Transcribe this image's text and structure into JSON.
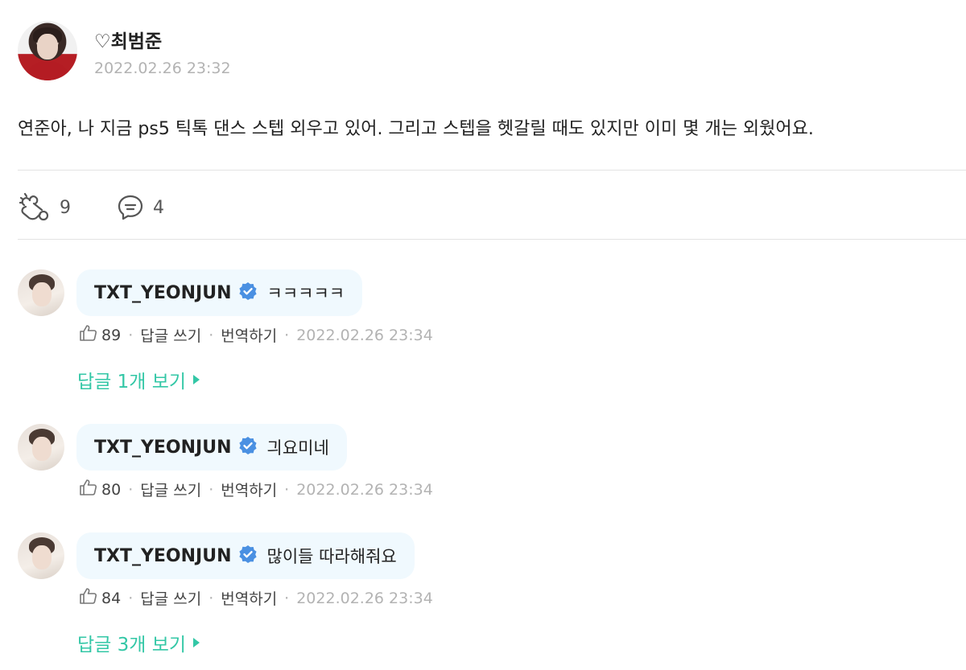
{
  "post": {
    "author": "♡최범준",
    "timestamp": "2022.02.26 23:32",
    "body": "연준아, 나 지금 ps5 틱톡 댄스 스텝 외우고 있어. 그리고 스텝을 헷갈릴 때도 있지만 이미 몇 개는 외웠어요.",
    "like_count": "9",
    "comment_count": "4"
  },
  "comments": [
    {
      "username": "TXT_YEONJUN",
      "text": "ㅋㅋㅋㅋㅋ",
      "likes": "89",
      "reply_label": "답글 쓰기",
      "translate_label": "번역하기",
      "timestamp": "2022.02.26 23:34",
      "view_replies": "답글 1개 보기"
    },
    {
      "username": "TXT_YEONJUN",
      "text": "긔요미네",
      "likes": "80",
      "reply_label": "답글 쓰기",
      "translate_label": "번역하기",
      "timestamp": "2022.02.26 23:34"
    },
    {
      "username": "TXT_YEONJUN",
      "text": "많이들 따라해줘요",
      "likes": "84",
      "reply_label": "답글 쓰기",
      "translate_label": "번역하기",
      "timestamp": "2022.02.26 23:34",
      "view_replies": "답글 3개 보기"
    }
  ],
  "colors": {
    "accent_green": "#33c7a6",
    "verified_blue": "#4a90e2",
    "bubble_bg": "#f0f9fe",
    "muted_text": "#b3b3b3"
  },
  "icons": {
    "like": "cheer-hand-icon",
    "comment": "comment-bubble-icon",
    "verified": "verified-badge-icon",
    "thumb": "thumbs-up-icon",
    "arrow": "triangle-right-icon"
  }
}
